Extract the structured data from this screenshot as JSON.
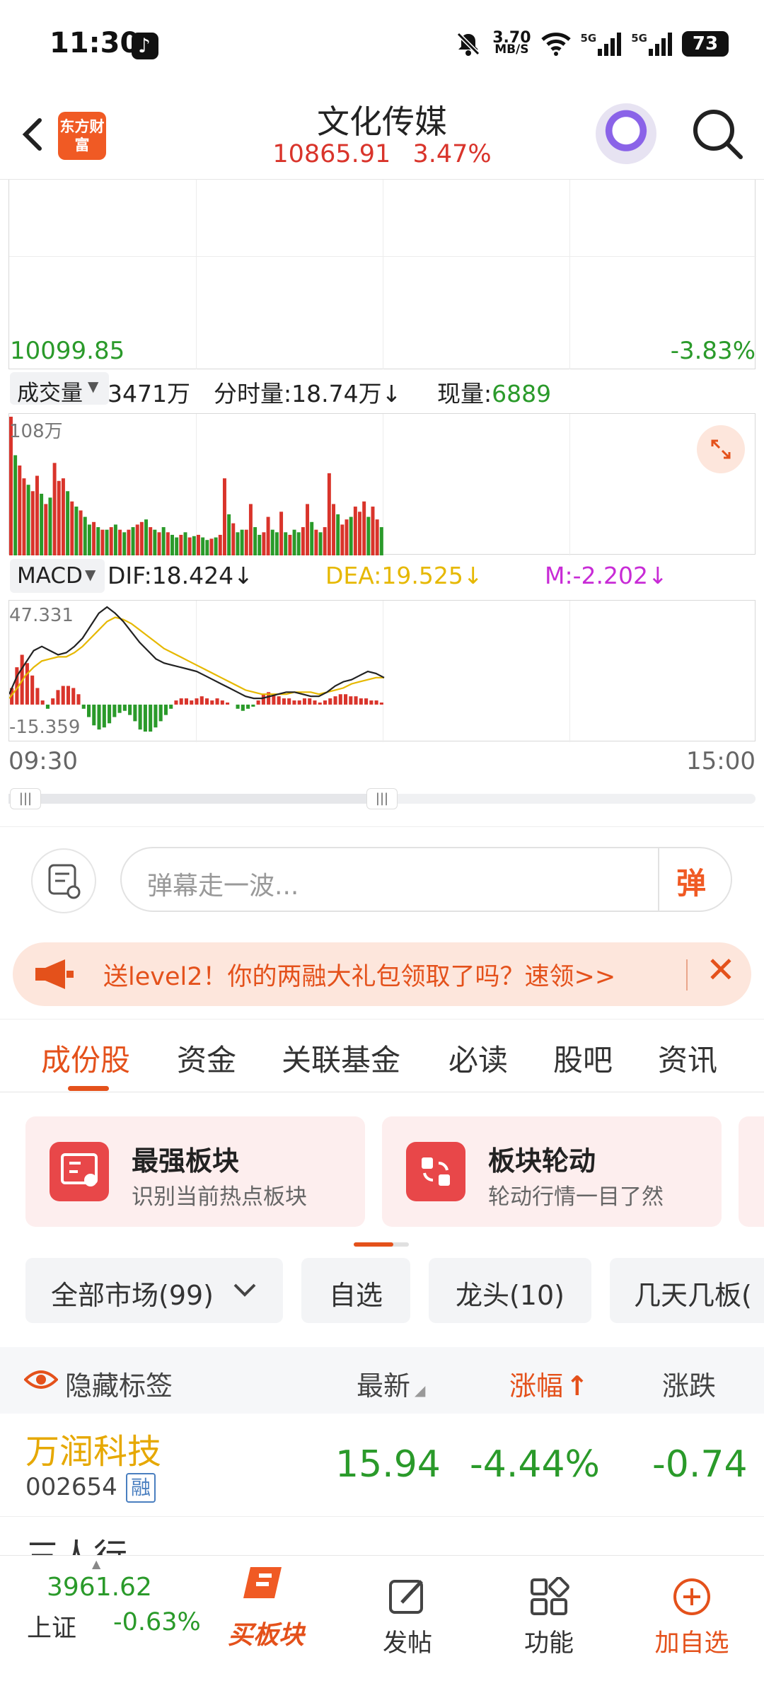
{
  "status_bar": {
    "time": "11:30",
    "speed_value": "3.70",
    "speed_unit": "MB/S",
    "network": "5G",
    "battery": "73",
    "icons": [
      "tiktok-icon",
      "mute-bell-icon",
      "wifi-icon",
      "signal-icon",
      "battery-icon"
    ]
  },
  "header": {
    "logo": "东方财富",
    "title": "文化传媒",
    "price": "10865.91",
    "change_pct": "3.47%",
    "colors": {
      "up": "#d9342b",
      "down": "#2a9a2a",
      "accent": "#e4511b"
    }
  },
  "chart": {
    "price_low": "10099.85",
    "pct_low": "-3.83%",
    "volume": {
      "selector": "成交量",
      "total": "3471万",
      "tick_label": "分时量:18.74万",
      "tick_arrow": "↓",
      "current_label": "现量:",
      "current_value": "6889",
      "max_label": "108万"
    },
    "macd": {
      "selector": "MACD",
      "dif": "DIF:18.424↓",
      "dea": "DEA:19.525↓",
      "m": "M:-2.202↓",
      "max_label": "47.331",
      "min_label": "-15.359"
    },
    "time_start": "09:30",
    "time_end": "15:00"
  },
  "chart_data": [
    {
      "type": "bar",
      "name": "volume",
      "ymax": 108,
      "values": [
        108,
        78,
        70,
        60,
        55,
        50,
        62,
        48,
        40,
        45,
        72,
        58,
        60,
        50,
        42,
        38,
        35,
        30,
        24,
        26,
        22,
        20,
        20,
        22,
        24,
        20,
        18,
        20,
        22,
        24,
        26,
        28,
        22,
        20,
        18,
        22,
        18,
        16,
        14,
        16,
        18,
        14,
        15,
        16,
        14,
        12,
        13,
        14,
        16,
        60,
        32,
        25,
        18,
        20,
        20,
        40,
        22,
        16,
        18,
        30,
        20,
        18,
        34,
        18,
        16,
        20,
        18,
        22,
        40,
        26,
        20,
        18,
        22,
        64,
        40,
        32,
        24,
        28,
        30,
        38,
        34,
        42,
        30,
        38,
        28,
        22
      ],
      "up": [
        1,
        0,
        1,
        1,
        0,
        1,
        1,
        0,
        1,
        0,
        1,
        1,
        1,
        0,
        1,
        0,
        1,
        0,
        0,
        1,
        0,
        1,
        0,
        1,
        0,
        1,
        0,
        1,
        0,
        1,
        1,
        0,
        1,
        0,
        1,
        0,
        1,
        0,
        0,
        1,
        0,
        1,
        0,
        1,
        0,
        0,
        1,
        0,
        1,
        1,
        0,
        1,
        0,
        0,
        1,
        1,
        0,
        0,
        1,
        1,
        0,
        0,
        1,
        0,
        1,
        0,
        0,
        1,
        1,
        0,
        1,
        0,
        1,
        1,
        1,
        0,
        1,
        1,
        0,
        1,
        1,
        1,
        0,
        1,
        1,
        0
      ]
    },
    {
      "type": "line",
      "name": "macd",
      "ylim": [
        -15.359,
        47.331
      ],
      "dif": [
        5,
        14,
        20,
        26,
        28,
        26,
        24,
        25,
        28,
        32,
        38,
        44,
        47,
        44,
        40,
        35,
        30,
        26,
        22,
        20,
        19,
        18,
        17,
        16,
        14,
        12,
        10,
        8,
        6,
        4,
        3,
        3,
        4,
        5,
        6,
        6,
        5,
        4,
        4,
        6,
        9,
        11,
        12,
        14,
        16,
        15,
        13
      ],
      "dea": [
        3,
        8,
        14,
        18,
        21,
        22,
        23,
        23,
        25,
        28,
        32,
        36,
        40,
        42,
        41,
        39,
        36,
        33,
        30,
        27,
        25,
        23,
        21,
        19,
        17,
        15,
        13,
        11,
        9,
        7,
        6,
        5,
        5,
        5,
        5,
        6,
        6,
        6,
        5,
        6,
        7,
        8,
        10,
        11,
        12,
        13,
        13
      ],
      "hist": [
        8,
        18,
        24,
        20,
        14,
        8,
        2,
        -2,
        3,
        7,
        9,
        9,
        8,
        5,
        -2,
        -6,
        -10,
        -12,
        -11,
        -9,
        -6,
        -4,
        -3,
        -5,
        -8,
        -12,
        -13,
        -13,
        -11,
        -8,
        -5,
        -2,
        2,
        3,
        3,
        2,
        3,
        4,
        3,
        2,
        3,
        2,
        1,
        0,
        -2,
        -3,
        -2,
        -1,
        2,
        5,
        6,
        5,
        4,
        3,
        3,
        2,
        2,
        3,
        3,
        2,
        1,
        2,
        3,
        4,
        5,
        5,
        4,
        4,
        3,
        3,
        2,
        2,
        1
      ]
    }
  ],
  "barrage": {
    "placeholder": "弹幕走一波...",
    "button": "弹"
  },
  "promo": {
    "text": "送level2！你的两融大礼包领取了吗？速领>>"
  },
  "tabs": [
    "成份股",
    "资金",
    "关联基金",
    "必读",
    "股吧",
    "资讯"
  ],
  "cards": [
    {
      "title": "最强板块",
      "subtitle": "识别当前热点板块"
    },
    {
      "title": "板块轮动",
      "subtitle": "轮动行情一目了然"
    }
  ],
  "filters": {
    "market": "全部市场(99)",
    "watchlist": "自选",
    "leaders": "龙头(10)",
    "streak": "几天几板("
  },
  "table": {
    "hide_label": "隐藏标签",
    "col_latest": "最新",
    "col_change_pct": "涨幅",
    "col_change": "涨跌",
    "rows": [
      {
        "name": "万润科技",
        "code": "002654",
        "tag": "融",
        "latest": "15.94",
        "change_pct": "-4.44%",
        "change": "-0.74"
      },
      {
        "name": "三人行",
        "latest": "",
        "change_pct": "",
        "change": ""
      }
    ]
  },
  "bottom_nav": {
    "index_value": "3961.62",
    "index_name": "上证",
    "index_change": "-0.63%",
    "buy_block": "买板块",
    "post": "发帖",
    "functions": "功能",
    "add_watch": "加自选"
  }
}
